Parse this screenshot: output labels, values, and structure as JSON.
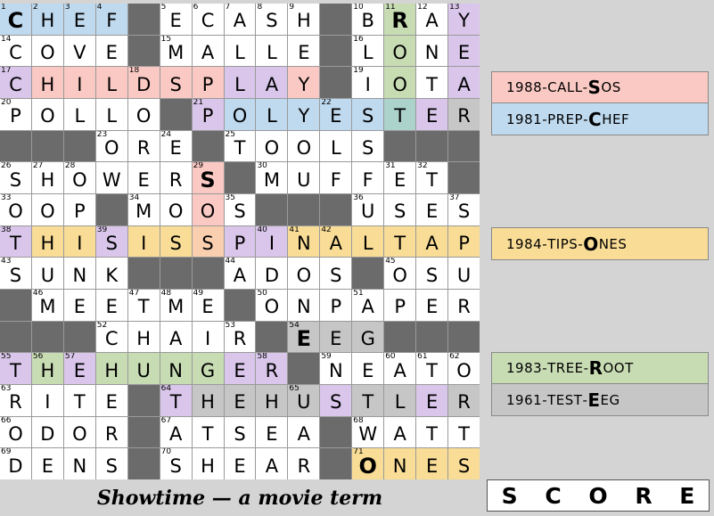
{
  "caption": "Showtime — a movie term",
  "score_label": "S C O R E",
  "palette": {
    "block": "#6b6b6b",
    "white": "#ffffff",
    "blue": "#bfd9ee",
    "pink": "#fac9c3",
    "purple": "#d9c6ea",
    "yellow": "#f9dd96",
    "green": "#c8dcb4",
    "teal": "#abd2cb",
    "gray": "#c6c6c6",
    "peach": "#f9cfb0",
    "bg": "#d4d4d4",
    "border": "#9a9a9a"
  },
  "clue_groups": [
    {
      "rows": [
        {
          "year": "1988",
          "word": "CALL",
          "answer_first": "S",
          "answer_rest": "OS",
          "color": "#fac9c3"
        },
        {
          "year": "1981",
          "word": "PREP",
          "answer_first": "C",
          "answer_rest": "HEF",
          "color": "#bfd9ee"
        }
      ]
    },
    {
      "rows": [
        {
          "year": "1984",
          "word": "TIPS",
          "answer_first": "O",
          "answer_rest": "NES",
          "color": "#f9dd96"
        }
      ]
    },
    {
      "rows": [
        {
          "year": "1983",
          "word": "TREE",
          "answer_first": "R",
          "answer_rest": "OOT",
          "color": "#c8dcb4"
        },
        {
          "year": "1961",
          "word": "TEST",
          "answer_first": "E",
          "answer_rest": "EG",
          "color": "#c6c6c6"
        }
      ]
    }
  ],
  "grid": {
    "cols": 15,
    "rows": 15,
    "cells": [
      [
        {
          "l": "C",
          "n": "1",
          "c": "blue",
          "b": true
        },
        {
          "l": "H",
          "n": "2",
          "c": "blue"
        },
        {
          "l": "E",
          "n": "3",
          "c": "blue"
        },
        {
          "l": "F",
          "n": "4",
          "c": "blue"
        },
        {
          "block": true
        },
        {
          "l": "E",
          "n": "5",
          "c": "white"
        },
        {
          "l": "C",
          "n": "6",
          "c": "white"
        },
        {
          "l": "A",
          "n": "7",
          "c": "white"
        },
        {
          "l": "S",
          "n": "8",
          "c": "white"
        },
        {
          "l": "H",
          "n": "9",
          "c": "white"
        },
        {
          "block": true
        },
        {
          "l": "B",
          "n": "10",
          "c": "white"
        },
        {
          "l": "R",
          "n": "11",
          "c": "green",
          "b": true
        },
        {
          "l": "A",
          "n": "12",
          "c": "white"
        },
        {
          "l": "Y",
          "n": "13",
          "c": "purple"
        }
      ],
      [
        {
          "l": "C",
          "n": "14",
          "c": "white"
        },
        {
          "l": "O",
          "c": "white"
        },
        {
          "l": "V",
          "c": "white"
        },
        {
          "l": "E",
          "c": "white"
        },
        {
          "block": true
        },
        {
          "l": "M",
          "n": "15",
          "c": "white"
        },
        {
          "l": "A",
          "c": "white"
        },
        {
          "l": "L",
          "c": "white"
        },
        {
          "l": "L",
          "c": "white"
        },
        {
          "l": "E",
          "c": "white"
        },
        {
          "block": true
        },
        {
          "l": "L",
          "n": "16",
          "c": "white"
        },
        {
          "l": "O",
          "c": "green"
        },
        {
          "l": "N",
          "c": "white"
        },
        {
          "l": "E",
          "c": "purple"
        }
      ],
      [
        {
          "l": "C",
          "n": "17",
          "c": "purple"
        },
        {
          "l": "H",
          "c": "pink"
        },
        {
          "l": "I",
          "c": "pink"
        },
        {
          "l": "L",
          "c": "pink"
        },
        {
          "l": "D",
          "n": "18",
          "c": "pink"
        },
        {
          "l": "S",
          "c": "pink"
        },
        {
          "l": "P",
          "c": "pink"
        },
        {
          "l": "L",
          "c": "purple"
        },
        {
          "l": "A",
          "c": "purple"
        },
        {
          "l": "Y",
          "c": "pink"
        },
        {
          "block": true
        },
        {
          "l": "I",
          "n": "19",
          "c": "white"
        },
        {
          "l": "O",
          "c": "green"
        },
        {
          "l": "T",
          "c": "white"
        },
        {
          "l": "A",
          "c": "purple"
        }
      ],
      [
        {
          "l": "P",
          "n": "20",
          "c": "white"
        },
        {
          "l": "O",
          "c": "white"
        },
        {
          "l": "L",
          "c": "white"
        },
        {
          "l": "L",
          "c": "white"
        },
        {
          "l": "O",
          "c": "white"
        },
        {
          "block": true
        },
        {
          "l": "P",
          "n": "21",
          "c": "purple"
        },
        {
          "l": "O",
          "c": "blue"
        },
        {
          "l": "L",
          "c": "blue"
        },
        {
          "l": "Y",
          "c": "blue"
        },
        {
          "l": "E",
          "n": "22",
          "c": "blue"
        },
        {
          "l": "S",
          "c": "blue"
        },
        {
          "l": "T",
          "c": "teal"
        },
        {
          "l": "E",
          "c": "purple"
        },
        {
          "l": "R",
          "c": "gray"
        }
      ],
      [
        {
          "block": true
        },
        {
          "block": true
        },
        {
          "block": true
        },
        {
          "l": "O",
          "n": "23",
          "c": "white"
        },
        {
          "l": "R",
          "c": "white"
        },
        {
          "l": "E",
          "n": "24",
          "c": "white"
        },
        {
          "block": true
        },
        {
          "l": "T",
          "n": "25",
          "c": "white"
        },
        {
          "l": "O",
          "c": "white"
        },
        {
          "l": "O",
          "c": "white"
        },
        {
          "l": "L",
          "c": "white"
        },
        {
          "l": "S",
          "c": "white"
        },
        {
          "block": true
        },
        {
          "block": true
        },
        {
          "block": true
        }
      ],
      [
        {
          "l": "S",
          "n": "26",
          "c": "white"
        },
        {
          "l": "H",
          "n": "27",
          "c": "white"
        },
        {
          "l": "O",
          "n": "28",
          "c": "white"
        },
        {
          "l": "W",
          "c": "white"
        },
        {
          "l": "E",
          "c": "white"
        },
        {
          "l": "R",
          "c": "white"
        },
        {
          "l": "S",
          "n": "29",
          "c": "pink",
          "b": true
        },
        {
          "block": true
        },
        {
          "l": "M",
          "n": "30",
          "c": "white"
        },
        {
          "l": "U",
          "c": "white"
        },
        {
          "l": "F",
          "c": "white"
        },
        {
          "l": "F",
          "c": "white"
        },
        {
          "l": "E",
          "n": "31",
          "c": "white"
        },
        {
          "l": "T",
          "n": "32",
          "c": "white"
        },
        {
          "block": true
        }
      ],
      [
        {
          "l": "O",
          "n": "33",
          "c": "white"
        },
        {
          "l": "O",
          "c": "white"
        },
        {
          "l": "P",
          "c": "white"
        },
        {
          "block": true
        },
        {
          "l": "M",
          "n": "34",
          "c": "white"
        },
        {
          "l": "O",
          "c": "white"
        },
        {
          "l": "O",
          "c": "pink"
        },
        {
          "l": "S",
          "n": "35",
          "c": "white"
        },
        {
          "block": true
        },
        {
          "block": true
        },
        {
          "block": true
        },
        {
          "l": "U",
          "n": "36",
          "c": "white"
        },
        {
          "l": "S",
          "c": "white"
        },
        {
          "l": "E",
          "c": "white"
        },
        {
          "l": "S",
          "n": "37",
          "c": "white"
        }
      ],
      [
        {
          "l": "T",
          "n": "38",
          "c": "purple"
        },
        {
          "l": "H",
          "c": "yellow"
        },
        {
          "l": "I",
          "c": "yellow"
        },
        {
          "l": "S",
          "n": "39",
          "c": "purple"
        },
        {
          "l": "I",
          "c": "yellow"
        },
        {
          "l": "S",
          "c": "yellow"
        },
        {
          "l": "S",
          "c": "peach"
        },
        {
          "l": "P",
          "c": "purple"
        },
        {
          "l": "I",
          "n": "40",
          "c": "purple"
        },
        {
          "l": "N",
          "n": "41",
          "c": "yellow"
        },
        {
          "l": "A",
          "n": "42",
          "c": "yellow"
        },
        {
          "l": "L",
          "c": "yellow"
        },
        {
          "l": "T",
          "c": "yellow"
        },
        {
          "l": "A",
          "c": "yellow"
        },
        {
          "l": "P",
          "c": "yellow"
        }
      ],
      [
        {
          "l": "S",
          "n": "43",
          "c": "white"
        },
        {
          "l": "U",
          "c": "white"
        },
        {
          "l": "N",
          "c": "white"
        },
        {
          "l": "K",
          "c": "white"
        },
        {
          "block": true
        },
        {
          "block": true
        },
        {
          "block": true
        },
        {
          "l": "A",
          "n": "44",
          "c": "white"
        },
        {
          "l": "D",
          "c": "white"
        },
        {
          "l": "O",
          "c": "white"
        },
        {
          "l": "S",
          "c": "white"
        },
        {
          "block": true
        },
        {
          "l": "O",
          "n": "45",
          "c": "white"
        },
        {
          "l": "S",
          "c": "white"
        },
        {
          "l": "U",
          "c": "white"
        }
      ],
      [
        {
          "block": true
        },
        {
          "l": "M",
          "n": "46",
          "c": "white"
        },
        {
          "l": "E",
          "c": "white"
        },
        {
          "l": "E",
          "c": "white"
        },
        {
          "l": "T",
          "n": "47",
          "c": "white"
        },
        {
          "l": "M",
          "n": "48",
          "c": "white"
        },
        {
          "l": "E",
          "n": "49",
          "c": "white"
        },
        {
          "block": true
        },
        {
          "l": "O",
          "n": "50",
          "c": "white"
        },
        {
          "l": "N",
          "c": "white"
        },
        {
          "l": "P",
          "c": "white"
        },
        {
          "l": "A",
          "n": "51",
          "c": "white"
        },
        {
          "l": "P",
          "c": "white"
        },
        {
          "l": "E",
          "c": "white"
        },
        {
          "l": "R",
          "c": "white"
        }
      ],
      [
        {
          "block": true
        },
        {
          "block": true
        },
        {
          "block": true
        },
        {
          "l": "C",
          "n": "52",
          "c": "white"
        },
        {
          "l": "H",
          "c": "white"
        },
        {
          "l": "A",
          "c": "white"
        },
        {
          "l": "I",
          "c": "white"
        },
        {
          "l": "R",
          "n": "53",
          "c": "white"
        },
        {
          "block": true
        },
        {
          "l": "E",
          "n": "54",
          "c": "gray",
          "b": true
        },
        {
          "l": "E",
          "c": "gray"
        },
        {
          "l": "G",
          "c": "gray"
        },
        {
          "block": true
        },
        {
          "block": true
        },
        {
          "block": true
        }
      ],
      [
        {
          "l": "T",
          "n": "55",
          "c": "purple"
        },
        {
          "l": "H",
          "n": "56",
          "c": "green"
        },
        {
          "l": "E",
          "n": "57",
          "c": "purple"
        },
        {
          "l": "H",
          "c": "green"
        },
        {
          "l": "U",
          "c": "green"
        },
        {
          "l": "N",
          "c": "green"
        },
        {
          "l": "G",
          "c": "green"
        },
        {
          "l": "E",
          "c": "purple"
        },
        {
          "l": "R",
          "n": "58",
          "c": "purple"
        },
        {
          "block": true
        },
        {
          "l": "N",
          "n": "59",
          "c": "white"
        },
        {
          "l": "E",
          "c": "white"
        },
        {
          "l": "A",
          "n": "60",
          "c": "white"
        },
        {
          "l": "T",
          "n": "61",
          "c": "white"
        },
        {
          "l": "O",
          "n": "62",
          "c": "white"
        }
      ],
      [
        {
          "l": "R",
          "n": "63",
          "c": "white"
        },
        {
          "l": "I",
          "c": "white"
        },
        {
          "l": "T",
          "c": "white"
        },
        {
          "l": "E",
          "c": "white"
        },
        {
          "block": true
        },
        {
          "l": "T",
          "n": "64",
          "c": "purple"
        },
        {
          "l": "H",
          "c": "gray"
        },
        {
          "l": "E",
          "c": "gray"
        },
        {
          "l": "H",
          "c": "gray"
        },
        {
          "l": "U",
          "n": "65",
          "c": "gray"
        },
        {
          "l": "S",
          "c": "purple"
        },
        {
          "l": "T",
          "c": "gray"
        },
        {
          "l": "L",
          "c": "gray"
        },
        {
          "l": "E",
          "c": "purple"
        },
        {
          "l": "R",
          "c": "gray"
        }
      ],
      [
        {
          "l": "O",
          "n": "66",
          "c": "white"
        },
        {
          "l": "D",
          "c": "white"
        },
        {
          "l": "O",
          "c": "white"
        },
        {
          "l": "R",
          "c": "white"
        },
        {
          "block": true
        },
        {
          "l": "A",
          "n": "67",
          "c": "white"
        },
        {
          "l": "T",
          "c": "white"
        },
        {
          "l": "S",
          "c": "white"
        },
        {
          "l": "E",
          "c": "white"
        },
        {
          "l": "A",
          "c": "white"
        },
        {
          "block": true
        },
        {
          "l": "W",
          "n": "68",
          "c": "white"
        },
        {
          "l": "A",
          "c": "white"
        },
        {
          "l": "T",
          "c": "white"
        },
        {
          "l": "T",
          "c": "white"
        }
      ],
      [
        {
          "l": "D",
          "n": "69",
          "c": "white"
        },
        {
          "l": "E",
          "c": "white"
        },
        {
          "l": "N",
          "c": "white"
        },
        {
          "l": "S",
          "c": "white"
        },
        {
          "block": true
        },
        {
          "l": "S",
          "n": "70",
          "c": "white"
        },
        {
          "l": "H",
          "c": "white"
        },
        {
          "l": "E",
          "c": "white"
        },
        {
          "l": "A",
          "c": "white"
        },
        {
          "l": "R",
          "c": "white"
        },
        {
          "block": true
        },
        {
          "l": "O",
          "n": "71",
          "c": "yellow",
          "b": true
        },
        {
          "l": "N",
          "c": "yellow"
        },
        {
          "l": "E",
          "c": "yellow"
        },
        {
          "l": "S",
          "c": "yellow"
        }
      ]
    ]
  }
}
